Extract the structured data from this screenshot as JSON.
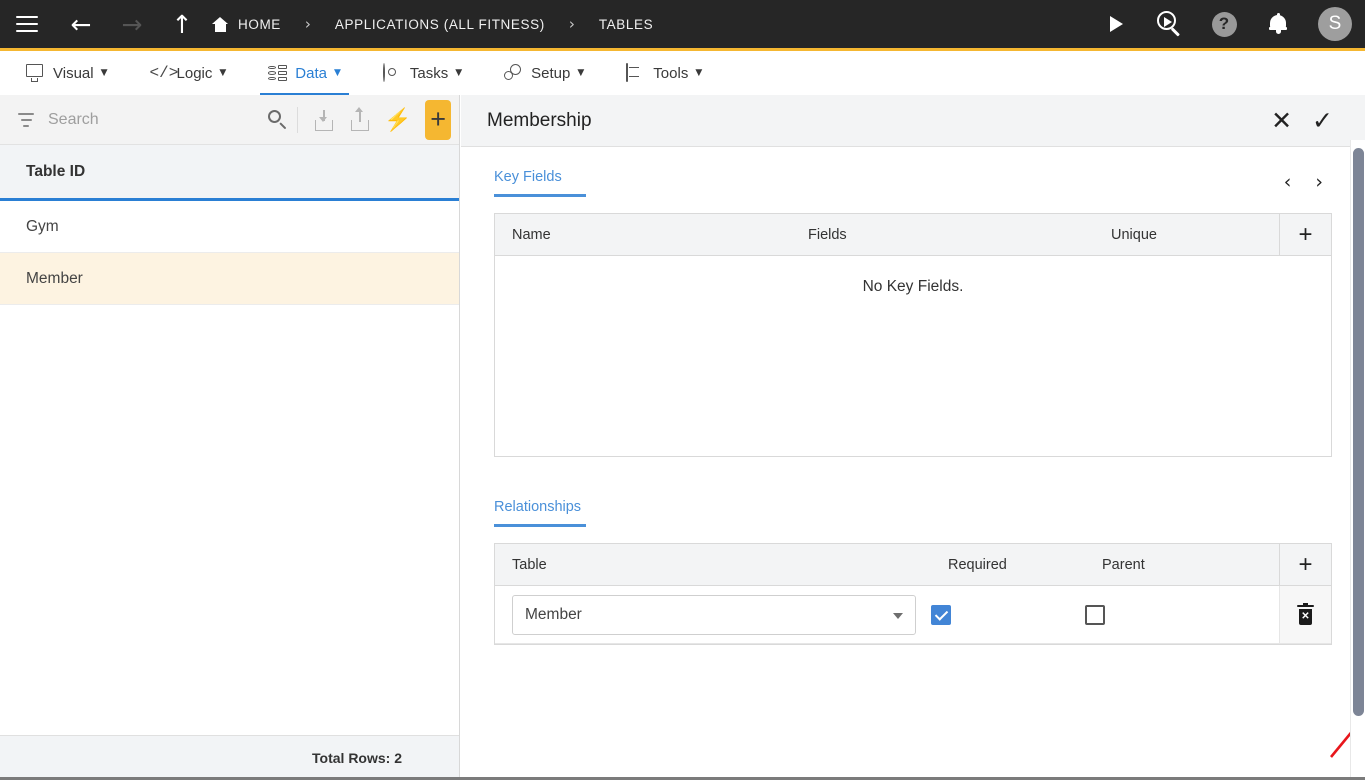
{
  "topbar": {
    "menu_icon": "hamburger-icon",
    "back_icon": "arrow-left-icon",
    "forward_icon": "arrow-right-icon",
    "up_icon": "arrow-up-icon",
    "home_icon": "home-icon",
    "breadcrumbs": [
      {
        "label": "HOME"
      },
      {
        "label": "APPLICATIONS (ALL FITNESS)"
      },
      {
        "label": "TABLES"
      }
    ],
    "separator": "›",
    "actions": [
      {
        "name": "run-icon"
      },
      {
        "name": "search-run-icon"
      },
      {
        "name": "help-icon",
        "label": "?"
      },
      {
        "name": "notifications-icon"
      }
    ],
    "avatar_initial": "S",
    "background": "#262626"
  },
  "menubar": {
    "accent_top": "#F5B731",
    "active_color": "#2a7fd4",
    "caret": "▼",
    "items": [
      {
        "label": "Visual",
        "icon": "monitor-icon",
        "active": false
      },
      {
        "label": "Logic",
        "icon": "code-icon",
        "active": false
      },
      {
        "label": "Data",
        "icon": "database-icon",
        "active": true
      },
      {
        "label": "Tasks",
        "icon": "target-icon",
        "active": false
      },
      {
        "label": "Setup",
        "icon": "gears-icon",
        "active": false
      },
      {
        "label": "Tools",
        "icon": "toolbox-icon",
        "active": false
      }
    ]
  },
  "sidebar": {
    "search": {
      "placeholder": "Search",
      "value": ""
    },
    "toolbar": [
      {
        "name": "filter-icon"
      },
      {
        "name": "search-icon"
      },
      {
        "name": "import-icon"
      },
      {
        "name": "export-icon"
      },
      {
        "name": "lightning-icon"
      },
      {
        "name": "add-button",
        "label": "+",
        "color": "#F5B731"
      }
    ],
    "column_header": "Table ID",
    "rows": [
      {
        "label": "Gym",
        "selected": false
      },
      {
        "label": "Member",
        "selected": true
      }
    ],
    "footer": "Total Rows: 2",
    "selected_row_color": "#fdf3e1"
  },
  "detail": {
    "title": "Membership",
    "close_label": "✕",
    "confirm_label": "✓",
    "prev_label": "‹",
    "next_label": "›",
    "key_fields": {
      "section_label": "Key Fields",
      "columns": [
        "Name",
        "Fields",
        "Unique"
      ],
      "add_label": "+",
      "empty_message": "No Key Fields."
    },
    "relationships": {
      "section_label": "Relationships",
      "columns": [
        "Table",
        "Required",
        "Parent"
      ],
      "add_label": "+",
      "rows": [
        {
          "table": "Member",
          "required": true,
          "parent": false,
          "delete_icon": "trash-icon"
        }
      ]
    },
    "annotation": {
      "name": "red-arrow-annotation",
      "color": "#e8161c"
    }
  }
}
